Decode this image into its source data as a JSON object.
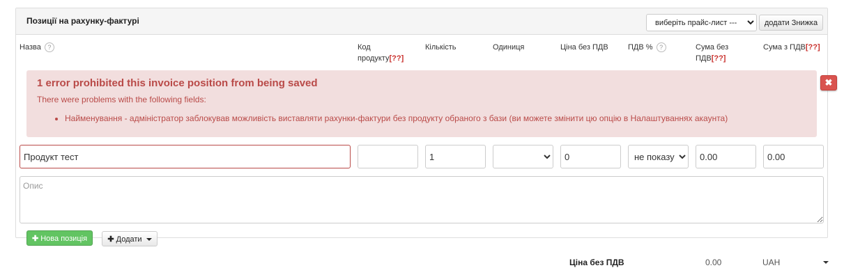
{
  "panel": {
    "title": "Позиції на рахунку-фактурі",
    "pricelist_select": "виберіть прайс-лист ---",
    "add_discount_label": "додати Знижка"
  },
  "columns": {
    "name": "Назва",
    "help": "?",
    "code": "Код продукту",
    "required_marker": "[??]",
    "quantity": "Кількість",
    "unit": "Одиниця",
    "price_net": "Ціна без ПДВ",
    "vat_percent": "ПДВ %",
    "sum_net": "Сума без ПДВ",
    "sum_gross": "Сума з ПДВ"
  },
  "error": {
    "title": "1 error prohibited this invoice position from being saved",
    "intro": "There were problems with the following fields:",
    "items": [
      "Найменування - адміністратор заблокував можливість виставляти рахунки-фактури без продукту обраного з бази (ви можете змінити цю опцію в Налаштуваннях акаунта)"
    ],
    "close_icon": "✖"
  },
  "row": {
    "name_value": "Продукт тест",
    "code_value": "",
    "quantity_value": "1",
    "unit_value": "",
    "price_value": "0",
    "vat_value": "не показу",
    "sum_net_value": "0.00",
    "sum_gross_value": "0.00",
    "description_placeholder": "Опис"
  },
  "actions": {
    "new_position_label": "Нова позиція",
    "add_label": "Додати"
  },
  "totals": {
    "label": "Ціна без ПДВ",
    "value": "0.00",
    "currency": "UAH"
  },
  "colors": {
    "error_bg": "#f2dede",
    "error_text": "#b94a48",
    "required": "#c9302c",
    "success_button": "#62c462",
    "danger_button": "#d9534f"
  }
}
